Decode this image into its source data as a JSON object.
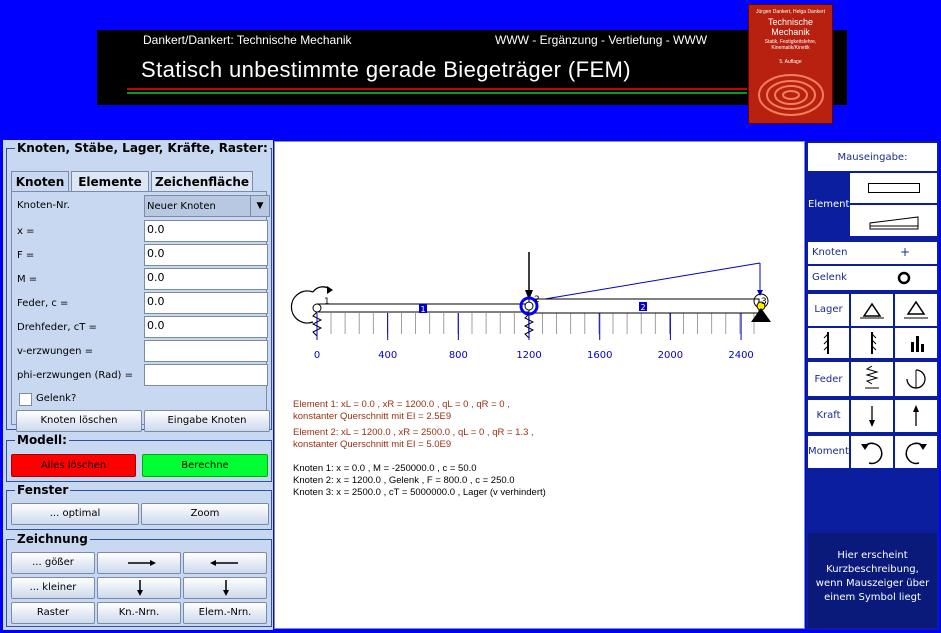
{
  "banner": {
    "left_text": "Dankert/Dankert: Technische Mechanik",
    "right_text": "WWW - Ergänzung - Vertiefung - WWW",
    "title": "Statisch  unbestimmte  gerade Biegeträger (FEM)",
    "stripe_colors": [
      "#cc0000",
      "#009933"
    ]
  },
  "book": {
    "authors": "Jürgen Dankert, Helga Dankert",
    "title": "Technische Mechanik",
    "subtitle": "Statik, Festigkeitslehre, Kinematik/Kinetik",
    "edition": "5. Auflage"
  },
  "left": {
    "group_title": "Knoten, Stäbe, Lager, Kräfte, Raster:",
    "tabs": [
      "Knoten",
      "Elemente",
      "Zeichenfläche"
    ],
    "active_tab": "Knoten",
    "fields": [
      {
        "label": "Knoten-Nr.",
        "value": "Neuer Knoten",
        "type": "select"
      },
      {
        "label": "x =",
        "value": "0.0"
      },
      {
        "label": "F =",
        "value": "0.0"
      },
      {
        "label": "M =",
        "value": "0.0"
      },
      {
        "label": "Feder, c =",
        "value": "0.0"
      },
      {
        "label": "Drehfeder, cT =",
        "value": "0.0"
      },
      {
        "label": "v-erzwungen =",
        "value": ""
      },
      {
        "label": "phi-erzwungen (Rad) =",
        "value": ""
      }
    ],
    "gelenk_label": "Gelenk?",
    "delete_button": "Knoten löschen",
    "enter_button": "Eingabe Knoten"
  },
  "modell": {
    "title": "Modell:",
    "clear": "Alles löschen",
    "compute": "Berechne",
    "clear_color": "#ff0000",
    "compute_color": "#00ff33"
  },
  "fenster": {
    "title": "Fenster",
    "optimal": "... optimal",
    "zoom": "Zoom"
  },
  "zeichnung": {
    "title": "Zeichnung",
    "bigger": "... gößer",
    "smaller": "... kleiner",
    "raster": "Raster",
    "kn_nrn": "Kn.-Nrn.",
    "elem_nrn": "Elem.-Nrn.",
    "icons": [
      "arrow-right-icon",
      "arrow-left-icon",
      "arrow-down-icon",
      "arrow-down-icon"
    ]
  },
  "canvas": {
    "axis_ticks": [
      "0",
      "400",
      "800",
      "1200",
      "1600",
      "2000",
      "2400"
    ],
    "node_labels": [
      "1",
      "2",
      "3"
    ],
    "element_labels": [
      "1",
      "2"
    ],
    "element_lines": [
      "Element 1:  xL = 0.0 ,   xR = 1200.0 ,   qL = 0 ,   qR = 0 ,",
      "konstanter Querschnitt mit EI = 2.5E9",
      "Element 2:  xL = 1200.0 ,   xR = 2500.0 ,   qL = 0 ,   qR = 1.3 ,",
      "konstanter Querschnitt mit EI = 5.0E9"
    ],
    "node_lines": [
      "Knoten 1:  x = 0.0 ,  M = -250000.0 ,  c = 50.0",
      "Knoten 2:  x = 1200.0 ,  Gelenk ,  F = 800.0 ,  c = 250.0",
      "Knoten 3:  x = 2500.0 ,  cT = 5000000.0 ,  Lager (v verhindert)"
    ]
  },
  "right": {
    "title": "Mauseingabe:",
    "element": "Element",
    "knoten": "Knoten",
    "knoten_symbol": "+",
    "gelenk": "Gelenk",
    "lager": "Lager",
    "feder": "Feder",
    "kraft": "Kraft",
    "moment": "Moment",
    "help": "Hier erscheint Kurzbeschreibung, wenn Mauszeiger über einem Symbol liegt"
  }
}
